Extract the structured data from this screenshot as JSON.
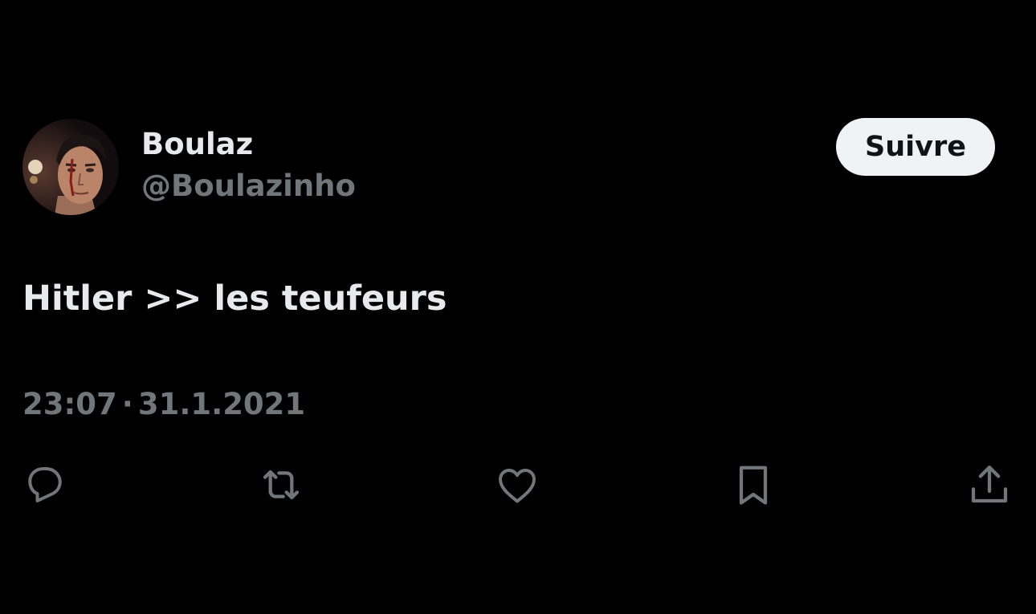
{
  "author": {
    "display_name": "Boulaz",
    "handle": "@Boulazinho",
    "avatar": "boxer-portrait-avatar"
  },
  "follow_button": {
    "label": "Suivre"
  },
  "tweet": {
    "text": "Hitler >> les teufeurs",
    "time": "23:07",
    "separator": "·",
    "date": "31.1.2021"
  },
  "actions": [
    {
      "name": "reply",
      "icon": "speech-bubble-icon"
    },
    {
      "name": "retweet",
      "icon": "retweet-arrows-icon"
    },
    {
      "name": "like",
      "icon": "heart-icon"
    },
    {
      "name": "bookmark",
      "icon": "bookmark-icon"
    },
    {
      "name": "share",
      "icon": "share-upload-icon"
    }
  ],
  "colors": {
    "background": "#000000",
    "primary_text": "#e7e9ea",
    "secondary_text": "#71767b",
    "button_bg": "#eff3f4",
    "button_text": "#0f1419"
  }
}
